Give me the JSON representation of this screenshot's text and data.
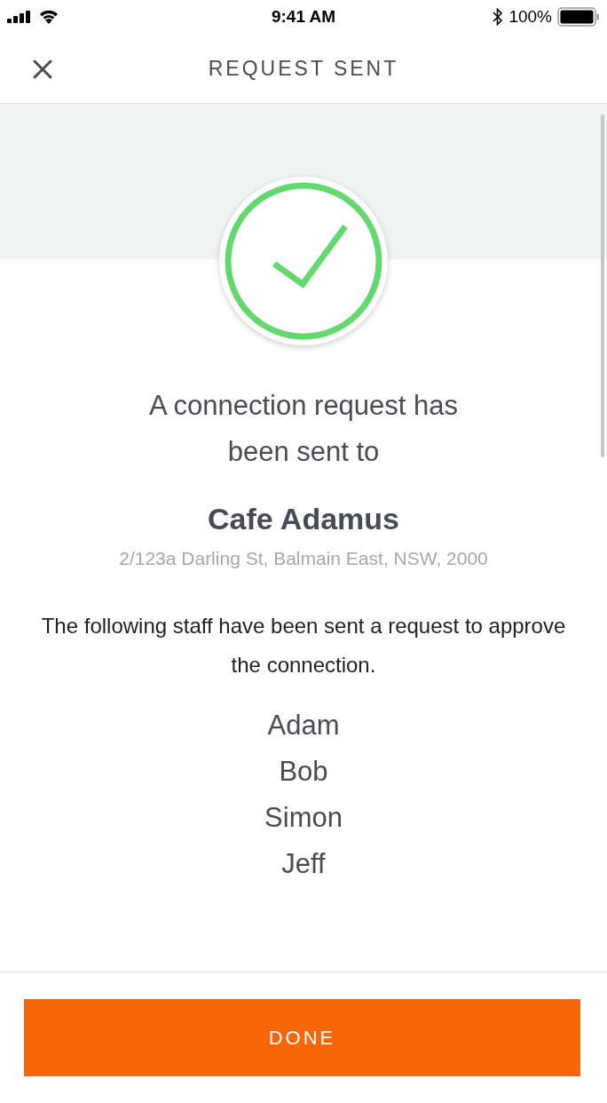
{
  "status_bar": {
    "time": "9:41 AM",
    "battery": "100%"
  },
  "header": {
    "title": "REQUEST SENT"
  },
  "message": "A connection request has been sent to",
  "venue": {
    "name": "Cafe Adamus",
    "address": "2/123a Darling St, Balmain East, NSW, 2000"
  },
  "staff_note": "The following staff have been sent a request to approve the connection.",
  "staff": [
    "Adam",
    "Bob",
    "Simon",
    "Jeff"
  ],
  "done_button": "DONE"
}
